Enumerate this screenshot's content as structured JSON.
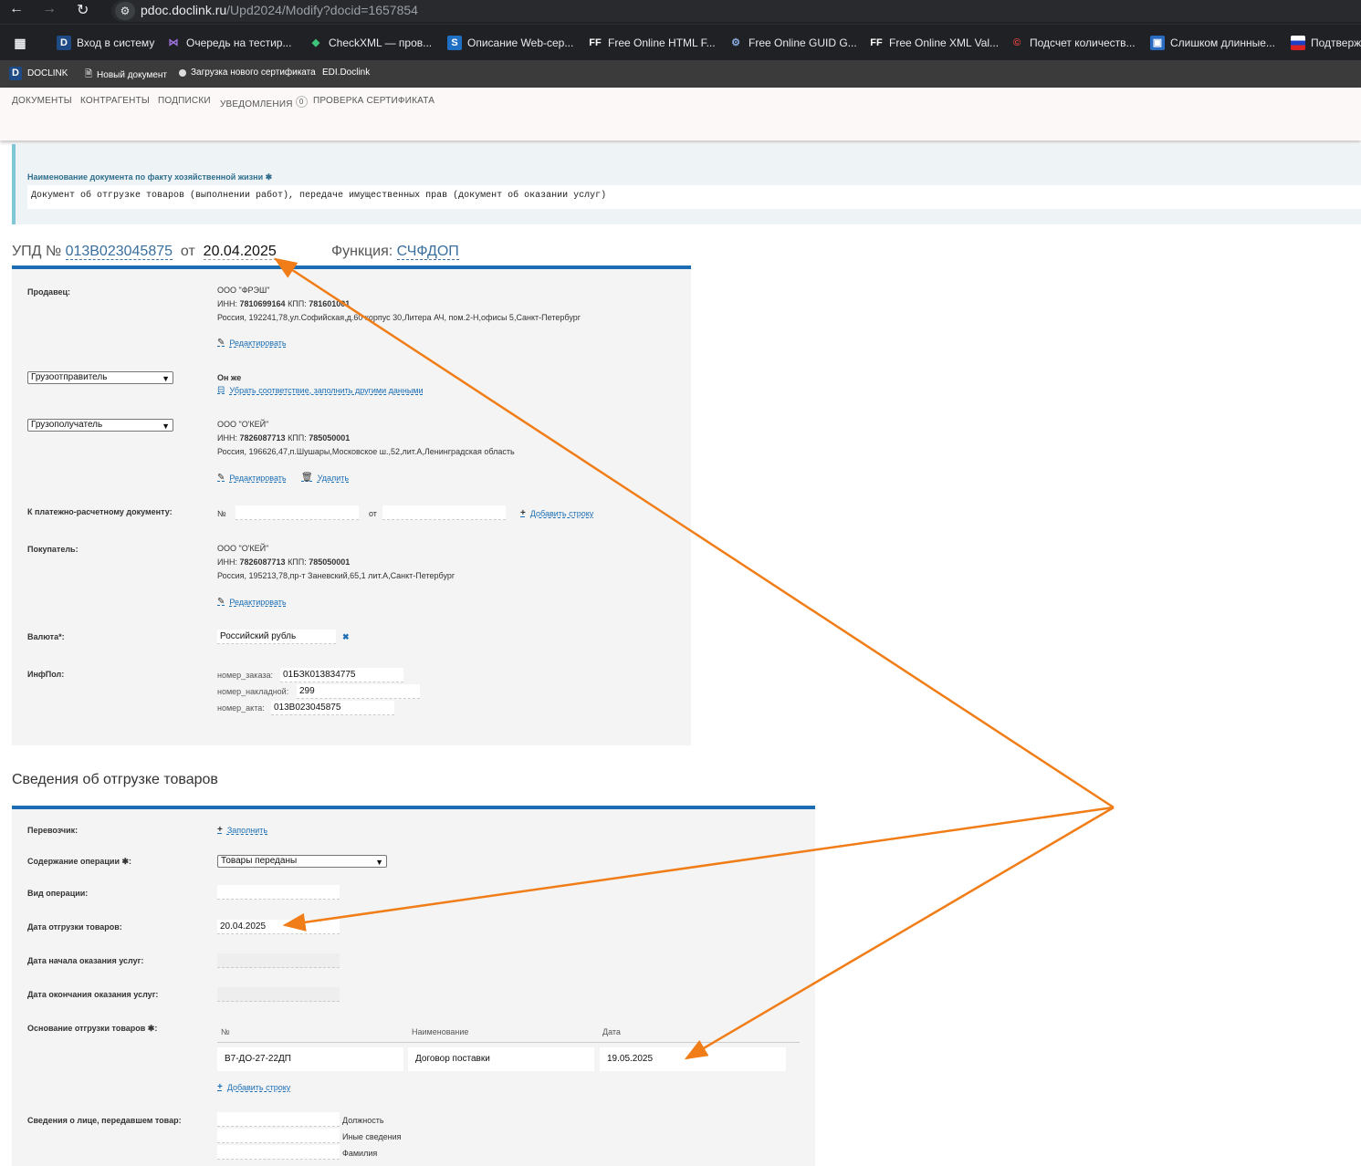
{
  "browser": {
    "url_host": "pdoc.doclink.ru",
    "url_path": "/Upd2024/Modify?docid=1657854",
    "bookmarks": [
      {
        "label": "Вход в систему",
        "icon": "doclink-icon"
      },
      {
        "label": "Очередь на тестир...",
        "icon": "visualstudio-icon"
      },
      {
        "label": "CheckXML — пров...",
        "icon": "checkxml-icon"
      },
      {
        "label": "Описание Web-сер...",
        "icon": "web-service-icon"
      },
      {
        "label": "Free Online HTML F...",
        "icon": "ff-icon"
      },
      {
        "label": "Free Online GUID G...",
        "icon": "gears-icon"
      },
      {
        "label": "Free Online XML Val...",
        "icon": "ff-icon"
      },
      {
        "label": "Подсчет количеств...",
        "icon": "copyright-icon"
      },
      {
        "label": "Слишком длинные...",
        "icon": "window-icon"
      },
      {
        "label": "Подтверж",
        "icon": "flag-ru-icon"
      }
    ]
  },
  "appbar": {
    "logo": "DOCLINK",
    "new_doc": "Новый документ",
    "upload_cert": "Загрузка нового сертификата",
    "edi": "EDI.Doclink"
  },
  "nav": {
    "documents": "ДОКУМЕНТЫ",
    "counterparties": "КОНТРАГЕНТЫ",
    "signatures": "ПОДПИСКИ",
    "notifications": "УВЕДОМЛЕНИЯ",
    "notifications_count": "0",
    "check_cert": "ПРОВЕРКА СЕРТИФИКАТА"
  },
  "doc_name": {
    "label": "Наименование документа по факту хозяйственной жизни ✱",
    "value": "Документ об отгрузке товаров (выполнении работ), передаче имущественных прав (документ об оказании услуг)"
  },
  "header": {
    "prefix": "УПД №",
    "number": "013В023045875",
    "from": "от",
    "date": "20.04.2025",
    "function_label": "Функция:",
    "function_value": "СЧФДОП"
  },
  "seller": {
    "label": "Продавец:",
    "name": "ООО \"ФРЭШ\"",
    "inn_label": "ИНН:",
    "inn": "7810699164",
    "kpp_label": "КПП:",
    "kpp": "781601001",
    "address": "Россия, 192241,78,ул.Софийская,д.60 корпус 30,Литера АЧ, пом.2-Н,офисы 5,Санкт-Петербург",
    "edit": "Редактировать"
  },
  "shipper": {
    "select": "Грузоотправитель",
    "same": "Он же",
    "remove_link": "Убрать соответствие, заполнить другими данными"
  },
  "consignee": {
    "select": "Грузополучатель",
    "name": "ООО \"О'КЕЙ\"",
    "inn_label": "ИНН:",
    "inn": "7826087713",
    "kpp_label": "КПП:",
    "kpp": "785050001",
    "address": "Россия, 196626,47,п.Шушары,Московское ш.,52,лит.А,Ленинградская область",
    "edit": "Редактировать",
    "delete": "Удалить"
  },
  "payment_doc": {
    "label": "К платежно-расчетному документу:",
    "num_label": "№",
    "from_label": "от",
    "add": "Добавить строку"
  },
  "buyer": {
    "label": "Покупатель:",
    "name": "ООО \"О'КЕЙ\"",
    "inn_label": "ИНН:",
    "inn": "7826087713",
    "kpp_label": "КПП:",
    "kpp": "785050001",
    "address": "Россия, 195213,78,пр-т Заневский,65,1 лит.А,Санкт-Петербург",
    "edit": "Редактировать"
  },
  "currency": {
    "label": "Валюта*:",
    "value": "Российский рубль",
    "clear": "✖"
  },
  "infpol": {
    "label": "ИнфПол:",
    "rows": [
      {
        "key": "номер_заказа:",
        "value": "01БЗК013834775"
      },
      {
        "key": "номер_накладной:",
        "value": "299"
      },
      {
        "key": "номер_акта:",
        "value": "013В023045875"
      }
    ]
  },
  "shipment": {
    "title": "Сведения об отгрузке товаров",
    "carrier_label": "Перевозчик:",
    "carrier_fill": "Заполнить",
    "operation_label": "Содержание операции ✱:",
    "operation_value": "Товары переданы",
    "op_type_label": "Вид операции:",
    "ship_date_label": "Дата отгрузки товаров:",
    "ship_date": "20.04.2025",
    "svc_start_label": "Дата начала оказания услуг:",
    "svc_end_label": "Дата окончания оказания услуг:",
    "basis_label": "Основание отгрузки товаров ✱:",
    "basis_cols": [
      "№",
      "Наименование",
      "Дата"
    ],
    "basis_row": [
      "В7-ДО-27-22ДП",
      "Договор поставки",
      "19.05.2025"
    ],
    "add_row": "Добавить строку",
    "person_label": "Сведения о лице, передавшем товар:",
    "position": "Должность",
    "other": "Иные сведения",
    "surname": "Фамилия"
  }
}
